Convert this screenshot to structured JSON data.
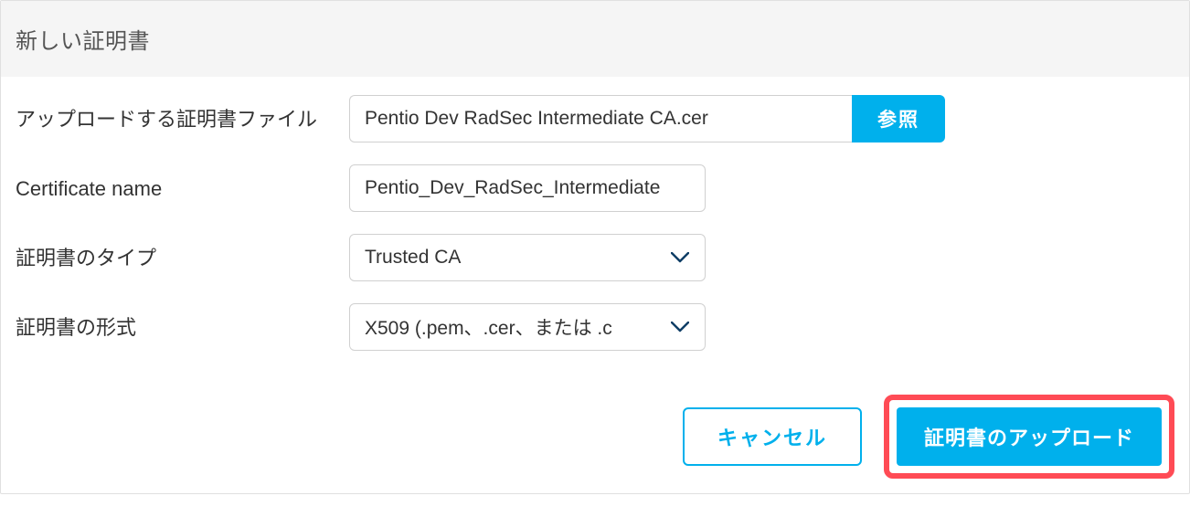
{
  "dialog": {
    "title": "新しい証明書"
  },
  "form": {
    "file": {
      "label": "アップロードする証明書ファイル",
      "value": "Pentio Dev RadSec Intermediate CA.cer",
      "browse": "参照"
    },
    "name": {
      "label": "Certificate name",
      "value": "Pentio_Dev_RadSec_Intermediate"
    },
    "type": {
      "label": "証明書のタイプ",
      "value": "Trusted CA"
    },
    "format": {
      "label": "証明書の形式",
      "value": "X509 (.pem、.cer、または .c"
    }
  },
  "footer": {
    "cancel": "キャンセル",
    "upload": "証明書のアップロード"
  },
  "colors": {
    "accent": "#00b0ec",
    "highlight": "#ff4b55"
  }
}
